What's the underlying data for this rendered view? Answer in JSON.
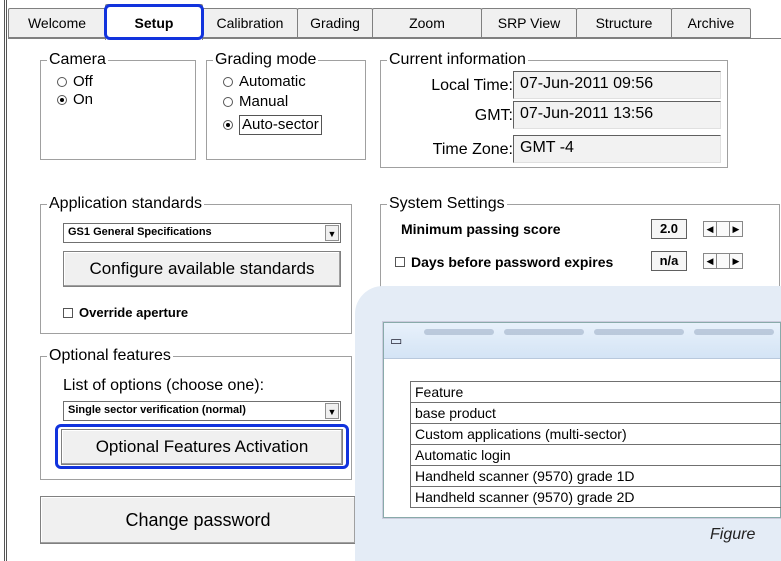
{
  "tabs": [
    {
      "label": "Welcome",
      "active": false
    },
    {
      "label": "Setup",
      "active": true
    },
    {
      "label": "Calibration",
      "active": false
    },
    {
      "label": "Grading",
      "active": false
    },
    {
      "label": "Zoom",
      "active": false
    },
    {
      "label": "SRP View",
      "active": false
    },
    {
      "label": "Structure",
      "active": false
    },
    {
      "label": "Archive",
      "active": false
    }
  ],
  "camera": {
    "title": "Camera",
    "options": [
      {
        "label": "Off",
        "selected": false
      },
      {
        "label": "On",
        "selected": true
      }
    ]
  },
  "grading_mode": {
    "title": "Grading mode",
    "options": [
      {
        "label": "Automatic",
        "selected": false
      },
      {
        "label": "Manual",
        "selected": false
      },
      {
        "label": "Auto-sector",
        "selected": true
      }
    ]
  },
  "current_info": {
    "title": "Current information",
    "local_time_label": "Local Time:",
    "local_time": "07-Jun-2011 09:56",
    "gmt_label": "GMT:",
    "gmt": "07-Jun-2011 13:56",
    "timezone_label": "Time Zone:",
    "timezone": "GMT -4"
  },
  "app_standards": {
    "title": "Application standards",
    "selected": "GS1 General Specifications",
    "configure_label": "Configure available standards",
    "override_label": "Override aperture"
  },
  "system_settings": {
    "title": "System Settings",
    "min_score_label": "Minimum passing score",
    "min_score_value": "2.0",
    "days_label": "Days before password expires",
    "days_value": "n/a"
  },
  "optional_features": {
    "title": "Optional features",
    "list_label": "List of options (choose one):",
    "selected": "Single sector verification (normal)",
    "activation_label": "Optional Features Activation"
  },
  "change_password_label": "Change password",
  "popup": {
    "header": "Feature",
    "rows": [
      "base product",
      "Custom applications (multi-sector)",
      "Automatic login",
      "Handheld scanner (9570) grade 1D",
      "Handheld scanner (9570) grade 2D"
    ]
  },
  "figure_caption": "Figure",
  "colors": {
    "highlight": "#1133dd",
    "overlay": "#e4ecf6"
  }
}
